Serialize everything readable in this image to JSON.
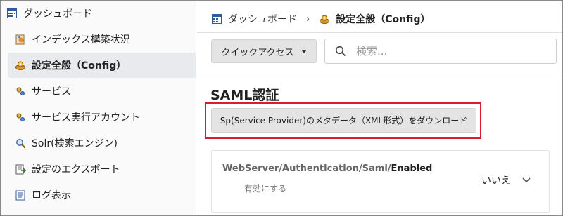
{
  "sidebar": {
    "items": [
      {
        "label": "ダッシュボード",
        "icon": "dashboard-grid-icon"
      },
      {
        "label": "インデックス構築状況",
        "icon": "index-build-icon"
      },
      {
        "label": "設定全般（Config）",
        "icon": "config-gear-icon",
        "active": true
      },
      {
        "label": "サービス",
        "icon": "service-icon"
      },
      {
        "label": "サービス実行アカウント",
        "icon": "service-account-icon"
      },
      {
        "label": "Solr(検索エンジン)",
        "icon": "magnifier-icon"
      },
      {
        "label": "設定のエクスポート",
        "icon": "export-icon"
      },
      {
        "label": "ログ表示",
        "icon": "log-icon"
      }
    ]
  },
  "breadcrumb": {
    "home": "ダッシュボード",
    "separator": "›",
    "current": "設定全般（Config）"
  },
  "toolbar": {
    "quick_access_label": "クイックアクセス",
    "search_placeholder": "検索..."
  },
  "section": {
    "title": "SAML認証",
    "download_button_label": "Sp(Service Provider)のメタデータ（XML形式）をダウンロード"
  },
  "setting": {
    "key_path": "WebServer/Authentication/Saml/",
    "key_leaf": "Enabled",
    "description": "有効にする",
    "value": "いいえ"
  },
  "colors": {
    "highlight_border": "#d4202a",
    "active_item_bg": "#e8eaee",
    "button_bg": "#e4e4e4"
  }
}
